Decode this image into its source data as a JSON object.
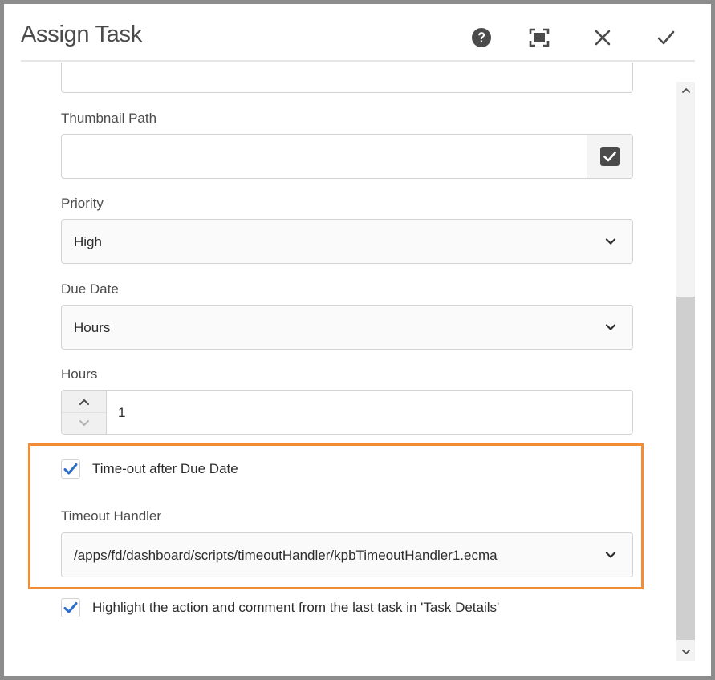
{
  "dialog": {
    "title": "Assign Task",
    "header_icons": [
      "help-icon",
      "fullscreen-icon",
      "close-icon",
      "done-icon"
    ]
  },
  "fields": {
    "thumbnail_path": {
      "label": "Thumbnail Path",
      "value": ""
    },
    "priority": {
      "label": "Priority",
      "selected": "High"
    },
    "due_date": {
      "label": "Due Date",
      "selected": "Hours"
    },
    "hours": {
      "label": "Hours",
      "value": "1"
    },
    "timeout_after_due": {
      "label": "Time-out after Due Date",
      "checked": true
    },
    "timeout_handler": {
      "label": "Timeout Handler",
      "selected": "/apps/fd/dashboard/scripts/timeoutHandler/kpbTimeoutHandler1.ecma"
    },
    "highlight_action": {
      "label": "Highlight the action and comment from the last task in 'Task Details'",
      "checked": true
    }
  },
  "colors": {
    "highlight_border": "#f28d35",
    "checkbox_check": "#2d6ec9",
    "icon": "#4b4b4b"
  }
}
